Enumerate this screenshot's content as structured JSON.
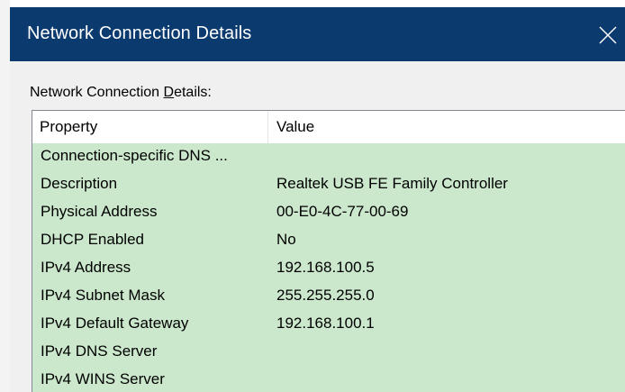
{
  "window": {
    "title": "Network Connection Details",
    "close_icon": "close-icon",
    "title_bar_color": "#0b3a6e",
    "selection_color": "#cbe8cc"
  },
  "group": {
    "label_prefix": "Network Connection ",
    "label_access_key": "D",
    "label_suffix": "etails:"
  },
  "table": {
    "columns": [
      "Property",
      "Value"
    ],
    "rows": [
      {
        "property": "Connection-specific DNS ...",
        "value": ""
      },
      {
        "property": "Description",
        "value": "Realtek USB FE Family Controller"
      },
      {
        "property": "Physical Address",
        "value": "00-E0-4C-77-00-69"
      },
      {
        "property": "DHCP Enabled",
        "value": "No"
      },
      {
        "property": "IPv4 Address",
        "value": "192.168.100.5"
      },
      {
        "property": "IPv4 Subnet Mask",
        "value": "255.255.255.0"
      },
      {
        "property": "IPv4 Default Gateway",
        "value": "192.168.100.1"
      },
      {
        "property": "IPv4 DNS Server",
        "value": ""
      },
      {
        "property": "IPv4 WINS Server",
        "value": ""
      }
    ]
  }
}
